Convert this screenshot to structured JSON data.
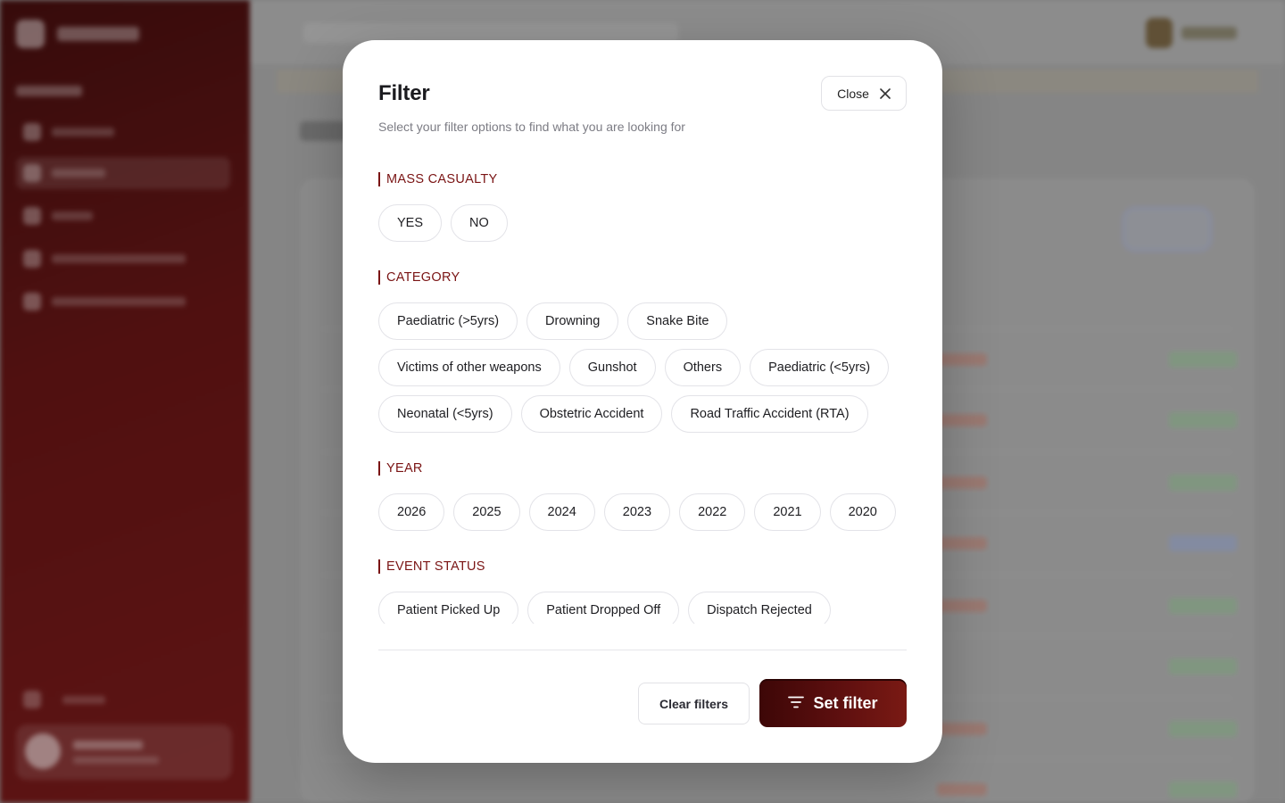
{
  "modal": {
    "title": "Filter",
    "subtitle": "Select your filter options to find what you are looking for",
    "close_label": "Close"
  },
  "sections": {
    "mass_casualty": {
      "heading": "MASS CASUALTY",
      "options": [
        "YES",
        "NO"
      ]
    },
    "category": {
      "heading": "CATEGORY",
      "rows": [
        [
          "Paediatric (>5yrs)",
          "Drowning",
          "Snake Bite"
        ],
        [
          "Victims of other weapons",
          "Gunshot",
          "Others",
          "Paediatric (<5yrs)"
        ],
        [
          "Neonatal (<5yrs)",
          "Obstetric Accident",
          "Road Traffic Accident (RTA)"
        ]
      ]
    },
    "year": {
      "heading": "YEAR",
      "options": [
        "2026",
        "2025",
        "2024",
        "2023",
        "2022",
        "2021",
        "2020"
      ]
    },
    "event_status": {
      "heading": "EVENT STATUS",
      "options": [
        "Patient Picked Up",
        "Patient Dropped Off",
        "Dispatch Rejected"
      ]
    }
  },
  "footer": {
    "clear_label": "Clear filters",
    "set_label": "Set filter"
  },
  "colors": {
    "accent": "#7a1414",
    "sidebar": "#5a0c0c",
    "chip_border": "#e3e3e8"
  }
}
